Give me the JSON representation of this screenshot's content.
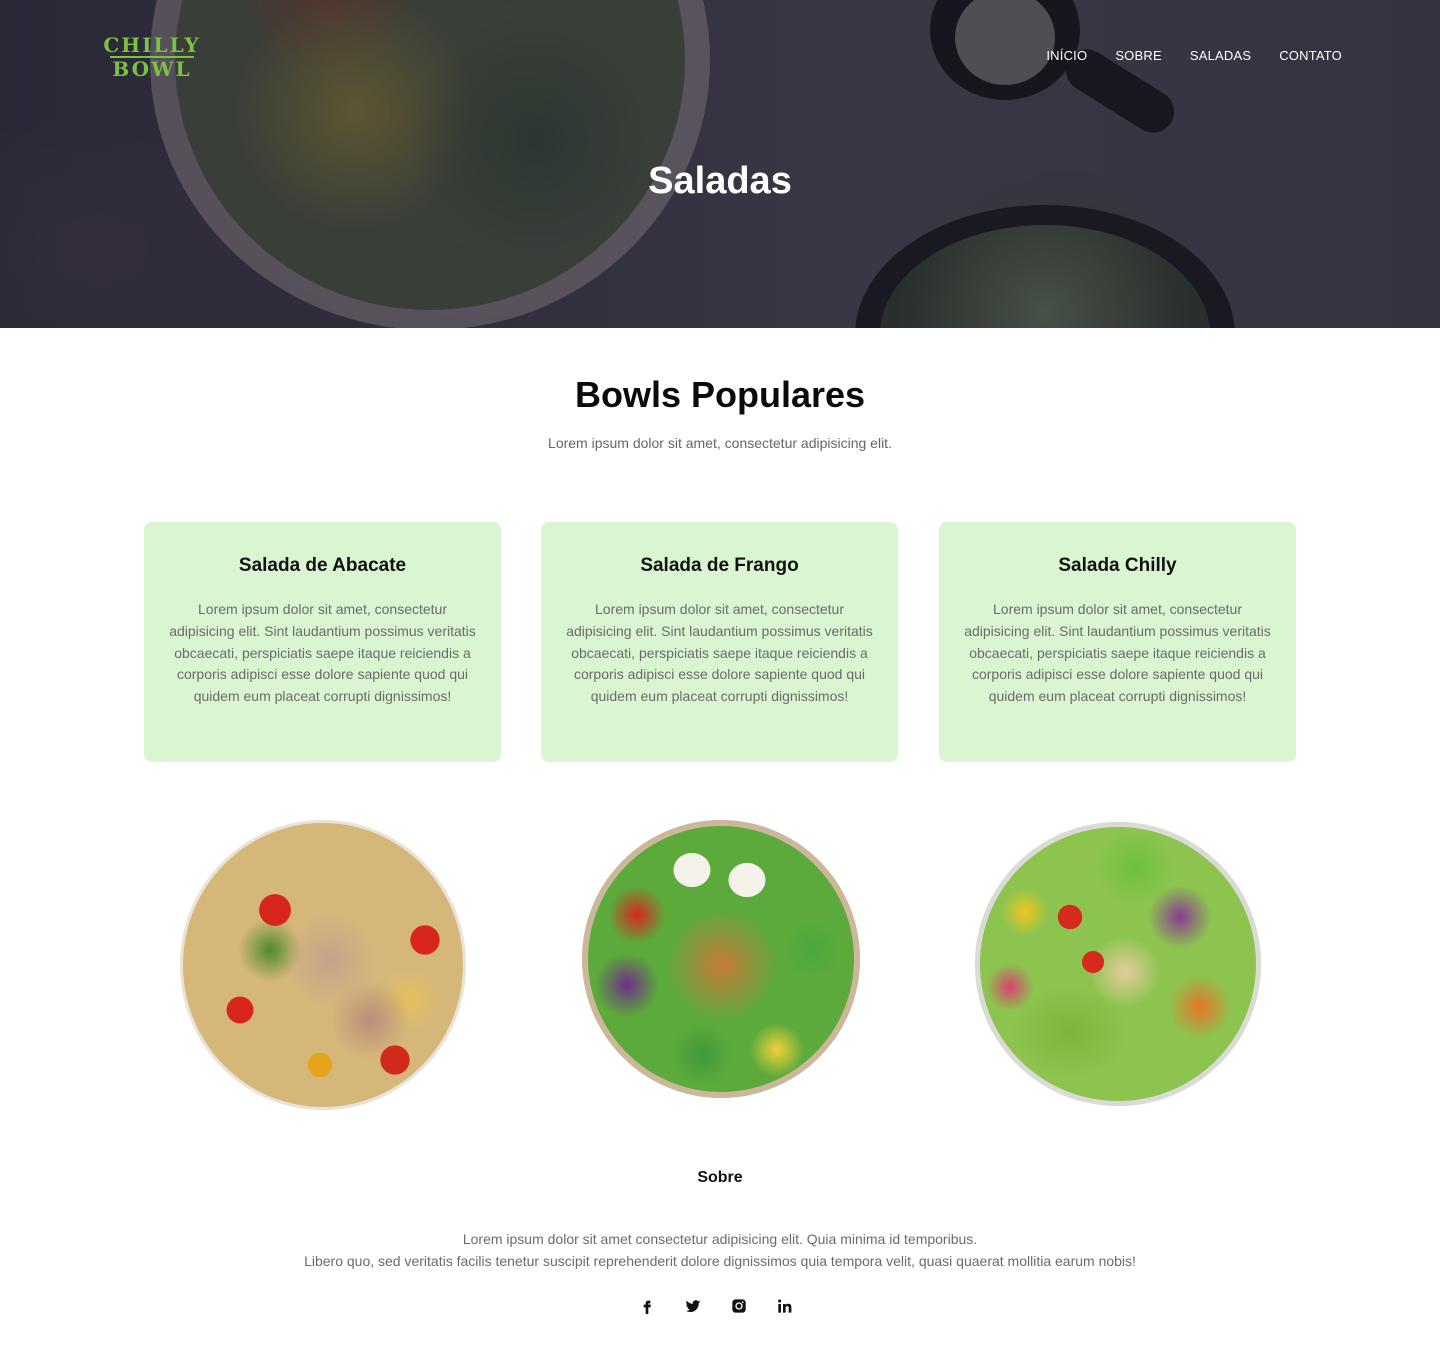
{
  "brand": {
    "logo_line1": "CHILLY",
    "logo_line2": "BOWL",
    "accent_color": "#7cc142"
  },
  "nav": {
    "items": [
      {
        "label": "INÍCIO"
      },
      {
        "label": "SOBRE"
      },
      {
        "label": "SALADAS"
      },
      {
        "label": "CONTATO"
      }
    ]
  },
  "hero": {
    "title": "Saladas"
  },
  "popular": {
    "title": "Bowls Populares",
    "subtitle": "Lorem ipsum dolor sit amet, consectetur adipisicing elit.",
    "card_color": "#d9f5d1",
    "cards": [
      {
        "title": "Salada de Abacate",
        "text": "Lorem ipsum dolor sit amet, consectetur adipisicing elit. Sint laudantium possimus veritatis obcaecati, perspiciatis saepe itaque reiciendis a corporis adipisci esse dolore sapiente quod qui quidem eum placeat corrupti dignissimos!"
      },
      {
        "title": "Salada de Frango",
        "text": "Lorem ipsum dolor sit amet, consectetur adipisicing elit. Sint laudantium possimus veritatis obcaecati, perspiciatis saepe itaque reiciendis a corporis adipisci esse dolore sapiente quod qui quidem eum placeat corrupti dignissimos!"
      },
      {
        "title": "Salada Chilly",
        "text": "Lorem ipsum dolor sit amet, consectetur adipisicing elit. Sint laudantium possimus veritatis obcaecati, perspiciatis saepe itaque reiciendis a corporis adipisci esse dolore sapiente quod qui quidem eum placeat corrupti dignissimos!"
      }
    ]
  },
  "about": {
    "title": "Sobre",
    "line1": "Lorem ipsum dolor sit amet consectetur adipisicing elit. Quia minima id temporibus.",
    "line2": "Libero quo, sed veritatis facilis tenetur suscipit reprehenderit dolore dignissimos quia tempora velit, quasi quaerat mollitia earum nobis!"
  },
  "social": {
    "icons": [
      "facebook-icon",
      "twitter-icon",
      "instagram-icon",
      "linkedin-icon"
    ]
  }
}
